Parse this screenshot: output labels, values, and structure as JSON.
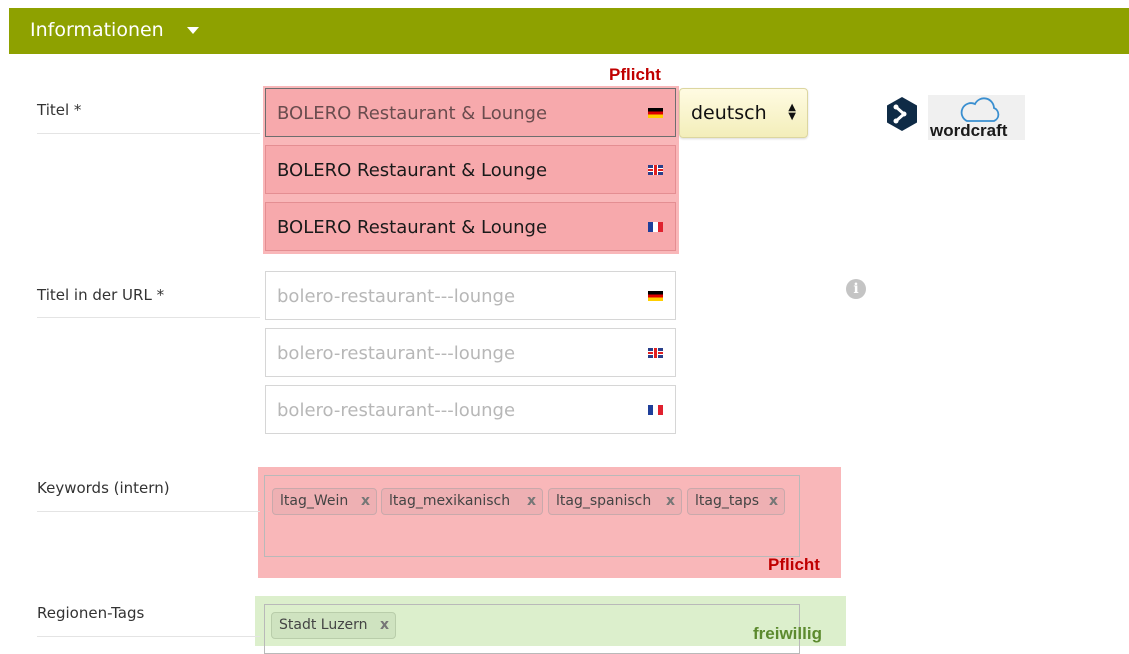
{
  "header": {
    "title": "Informationen"
  },
  "titel": {
    "label": "Titel *",
    "required_tag": "Pflicht",
    "values": {
      "de": "BOLERO Restaurant & Lounge",
      "en": "BOLERO Restaurant & Lounge",
      "fr": "BOLERO Restaurant & Lounge"
    },
    "language_select": "deutsch"
  },
  "url_title": {
    "label": "Titel in der URL *",
    "placeholders": {
      "de": "bolero-restaurant---lounge",
      "en": "bolero-restaurant---lounge",
      "fr": "bolero-restaurant---lounge"
    }
  },
  "keywords": {
    "label": "Keywords (intern)",
    "tags": [
      "ltag_Wein",
      "ltag_mexikanisch",
      "ltag_spanisch",
      "ltag_taps"
    ],
    "required_tag": "Pflicht"
  },
  "regions": {
    "label": "Regionen-Tags",
    "tags": [
      "Stadt Luzern"
    ],
    "optional_tag": "freiwillig"
  },
  "logos": {
    "wordcraft": "wordcraft"
  },
  "icons": {
    "remove": "x",
    "info": "i"
  },
  "colors": {
    "header": "#8ea100",
    "required": "#c00000",
    "optional": "#5c8a2e",
    "required_bg": "#f9b7b9",
    "optional_bg": "#dcefcc"
  }
}
